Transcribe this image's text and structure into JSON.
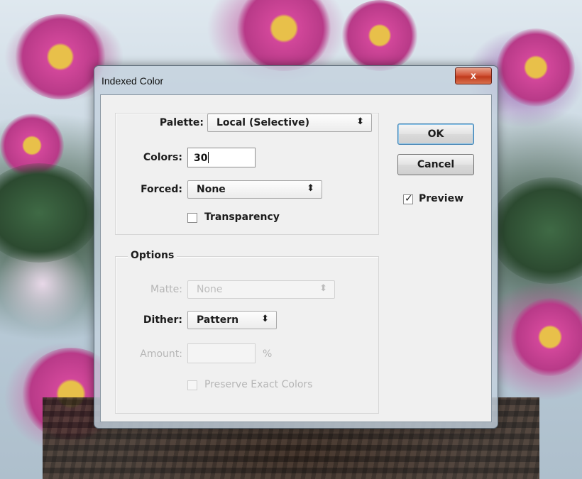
{
  "window": {
    "title": "Indexed Color",
    "close_glyph": "x"
  },
  "conversion": {
    "palette_label": "Palette:",
    "palette_value": "Local (Selective)",
    "colors_label": "Colors:",
    "colors_value": "30",
    "forced_label": "Forced:",
    "forced_value": "None",
    "transparency_label": "Transparency",
    "transparency_checked": false
  },
  "options": {
    "legend": "Options",
    "matte_label": "Matte:",
    "matte_value": "None",
    "matte_enabled": false,
    "dither_label": "Dither:",
    "dither_value": "Pattern",
    "amount_label": "Amount:",
    "amount_value": "",
    "amount_unit": "%",
    "amount_enabled": false,
    "preserve_label": "Preserve Exact Colors",
    "preserve_checked": false,
    "preserve_enabled": false
  },
  "buttons": {
    "ok_label": "OK",
    "cancel_label": "Cancel"
  },
  "preview": {
    "label": "Preview",
    "checked": true
  },
  "icons": {
    "close": "close-icon",
    "dropdown": "up-down-arrows-icon",
    "checkmark": "checkmark-icon"
  }
}
